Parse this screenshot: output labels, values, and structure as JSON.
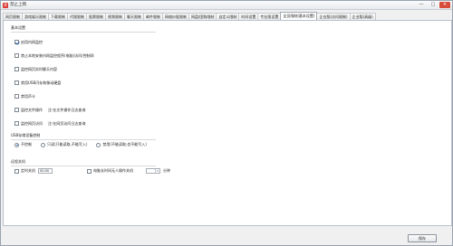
{
  "window": {
    "title": "禁止上网",
    "minimize_glyph": "—",
    "maximize_glyph": "□",
    "close_glyph": "✕"
  },
  "tabs": [
    {
      "label": "网页限制"
    },
    {
      "label": "游戏娱乐限制"
    },
    {
      "label": "下载限制"
    },
    {
      "label": "代理限制"
    },
    {
      "label": "股票限制"
    },
    {
      "label": "视频限制"
    },
    {
      "label": "聊天限制"
    },
    {
      "label": "邮件限制"
    },
    {
      "label": "网络炒股限制"
    },
    {
      "label": "网盘/团购限制"
    },
    {
      "label": "自定义限制"
    },
    {
      "label": "时间设置"
    },
    {
      "label": "专业版设置"
    },
    {
      "label": "全员限制(基本设置)"
    },
    {
      "label": "企业版(访问限制)"
    },
    {
      "label": "企业版(高级)"
    }
  ],
  "active_tab_index": 13,
  "basic": {
    "title": "基本设置",
    "options": [
      {
        "label": "启用内网监控",
        "checked": true
      },
      {
        "label": "禁止本地安装内网监控程序(电脑)访问/控制网",
        "checked": false
      },
      {
        "label": "监控网页实时聊天内容",
        "checked": false
      },
      {
        "label": "禁用USB闪存和移动硬盘",
        "checked": false
      },
      {
        "label": "禁用声卡",
        "checked": false
      },
      {
        "label": "监控文件操作",
        "checked": false,
        "note": "注:在文件操作日志查询"
      },
      {
        "label": "监控网页访问",
        "checked": false,
        "note": "注:在网页访问日志查询"
      }
    ]
  },
  "usb": {
    "title": "USB存储设备控制",
    "options": [
      {
        "label": "不控制",
        "checked": true
      },
      {
        "label": "只读(只能读取,不能写入)",
        "checked": false
      },
      {
        "label": "禁用(不能读取,也不能写入)",
        "checked": false
      }
    ]
  },
  "remote": {
    "title": "远程关机",
    "timed_shutdown_label": "定时关机",
    "timed_shutdown_checked": false,
    "time_value": "00:00",
    "idle_label": "电脑长时间无人操作关机",
    "idle_checked": false,
    "minutes_value": "",
    "minutes_unit": "分钟"
  },
  "footer": {
    "save_label": "保存"
  }
}
